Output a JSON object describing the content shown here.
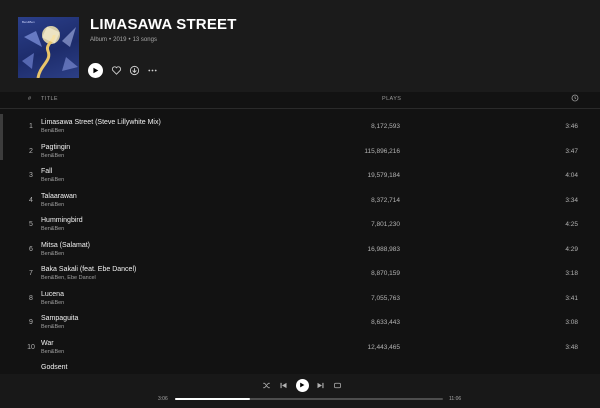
{
  "album": {
    "title": "LIMASAWA STREET",
    "type": "Album",
    "year": "2019",
    "song_count": "13 songs",
    "separator": "•",
    "cover_tag": "Ben&Ben"
  },
  "controls": {
    "icons": [
      "play-icon",
      "heart-icon",
      "download-icon",
      "more-icon"
    ]
  },
  "table_header": {
    "number": "#",
    "title": "TITLE",
    "plays": "PLAYS",
    "duration_icon": "clock-icon"
  },
  "tracks": [
    {
      "number": "1",
      "title": "Limasawa Street (Steve Lillywhite Mix)",
      "artist": "Ben&Ben",
      "plays": "8,172,593",
      "duration": "3:46"
    },
    {
      "number": "2",
      "title": "Pagtingin",
      "artist": "Ben&Ben",
      "plays": "115,896,216",
      "duration": "3:47"
    },
    {
      "number": "3",
      "title": "Fall",
      "artist": "Ben&Ben",
      "plays": "19,579,184",
      "duration": "4:04"
    },
    {
      "number": "4",
      "title": "Talaarawan",
      "artist": "Ben&Ben",
      "plays": "8,372,714",
      "duration": "3:34"
    },
    {
      "number": "5",
      "title": "Hummingbird",
      "artist": "Ben&Ben",
      "plays": "7,801,230",
      "duration": "4:25"
    },
    {
      "number": "6",
      "title": "Mitsa (Salamat)",
      "artist": "Ben&Ben",
      "plays": "16,988,983",
      "duration": "4:29"
    },
    {
      "number": "7",
      "title": "Baka Sakali (feat. Ebe Dancel)",
      "artist": "Ben&Ben, Ebe Dancel",
      "plays": "8,870,159",
      "duration": "3:18"
    },
    {
      "number": "8",
      "title": "Lucena",
      "artist": "Ben&Ben",
      "plays": "7,055,763",
      "duration": "3:41"
    },
    {
      "number": "9",
      "title": "Sampaguita",
      "artist": "Ben&Ben",
      "plays": "8,633,443",
      "duration": "3:08"
    },
    {
      "number": "10",
      "title": "War",
      "artist": "Ben&Ben",
      "plays": "12,443,465",
      "duration": "3:48"
    },
    {
      "number": "",
      "title": "Godsent",
      "artist": "",
      "plays": "",
      "duration": ""
    }
  ],
  "player": {
    "elapsed": "3:06",
    "total": "11:06",
    "progress_fraction": 0.28,
    "icons": [
      "shuffle-icon",
      "previous-icon",
      "play-icon",
      "next-icon",
      "repeat-icon"
    ]
  },
  "colors": {
    "background": "#121212",
    "header": "#1b1b1b",
    "text_primary": "#ffffff",
    "text_secondary": "#a7a7a7"
  }
}
